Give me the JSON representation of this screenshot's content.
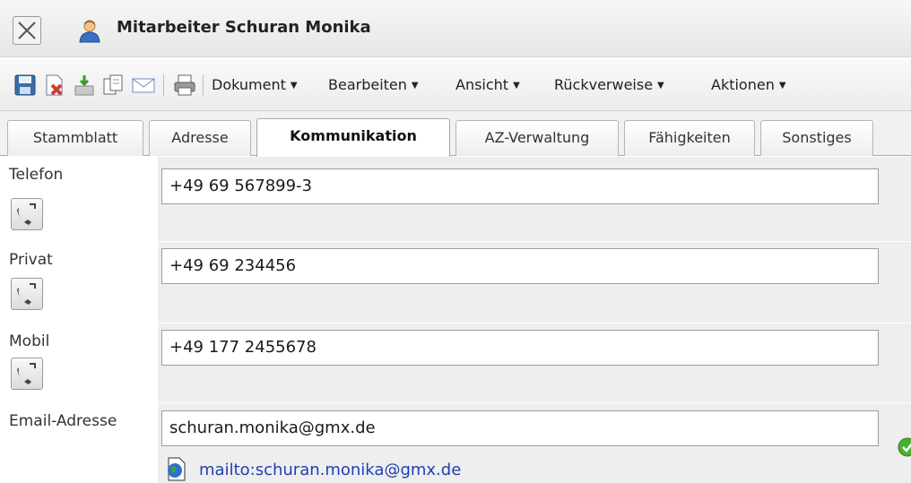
{
  "window": {
    "title": "Mitarbeiter Schuran Monika"
  },
  "toolbar": {
    "icons": [
      "save-icon",
      "delete-icon",
      "export-icon",
      "copy-icon",
      "email-icon",
      "print-icon"
    ],
    "menus": [
      {
        "label": "Dokument"
      },
      {
        "label": "Bearbeiten"
      },
      {
        "label": "Ansicht"
      },
      {
        "label": "Rückverweise"
      },
      {
        "label": "Aktionen"
      }
    ]
  },
  "tabs": [
    {
      "label": "Stammblatt"
    },
    {
      "label": "Adresse"
    },
    {
      "label": "Kommunikation",
      "active": true
    },
    {
      "label": "AZ-Verwaltung"
    },
    {
      "label": "Fähigkeiten"
    },
    {
      "label": "Sonstiges"
    }
  ],
  "form": {
    "telefon": {
      "label": "Telefon",
      "value": "+49 69 567899-3"
    },
    "privat": {
      "label": "Privat",
      "value": "+49 69 234456"
    },
    "mobil": {
      "label": "Mobil",
      "value": "+49 177 2455678"
    },
    "email": {
      "label": "Email-Adresse",
      "value": "schuran.monika@gmx.de",
      "mailto": "mailto:schuran.monika@gmx.de"
    }
  },
  "colors": {
    "link": "#1d3fb3",
    "field_bg": "#eeeeee",
    "accent_blue": "#3a6ea5"
  }
}
